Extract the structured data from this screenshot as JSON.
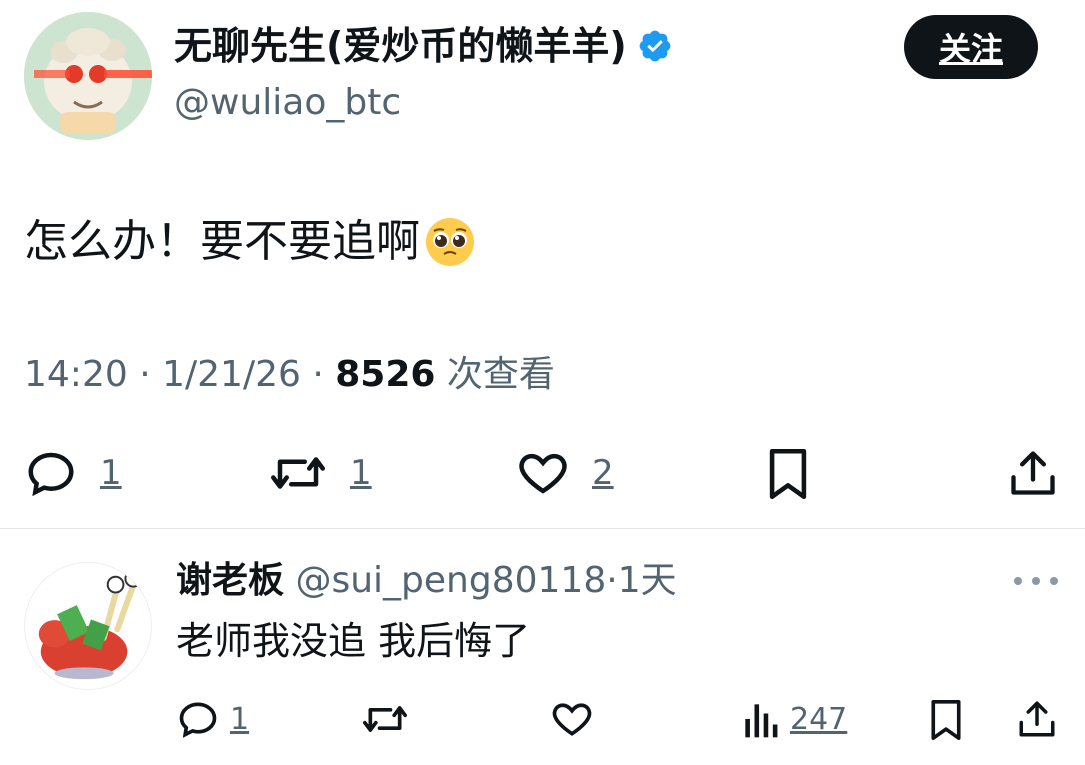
{
  "author": {
    "display_name": "无聊先生(爱炒币的懒羊羊)",
    "handle": "@wuliao_btc",
    "verified": true,
    "avatar_icon": "lazy-goat-laser-eyes-avatar"
  },
  "follow_label": "关注",
  "tweet": {
    "text": "怎么办！要不要追啊",
    "emoji_icon": "pleading-face-emoji",
    "time": "14:20",
    "date": "1/21/26",
    "views": "8526",
    "views_label": "次查看",
    "sep": "·"
  },
  "actions": {
    "reply_count": "1",
    "retweet_count": "1",
    "like_count": "2"
  },
  "reply": {
    "name": "谢老板",
    "handle": "@sui_peng80118",
    "time": "1天",
    "sep": "·",
    "text": "老师我没追 我后悔了",
    "reply_count": "1",
    "views": "247",
    "avatar_icon": "crab-with-money-avatar"
  },
  "colors": {
    "text": "#0f1419",
    "secondary": "#536471",
    "verified_blue": "#1d9bf0",
    "button_bg": "#0f1419"
  }
}
